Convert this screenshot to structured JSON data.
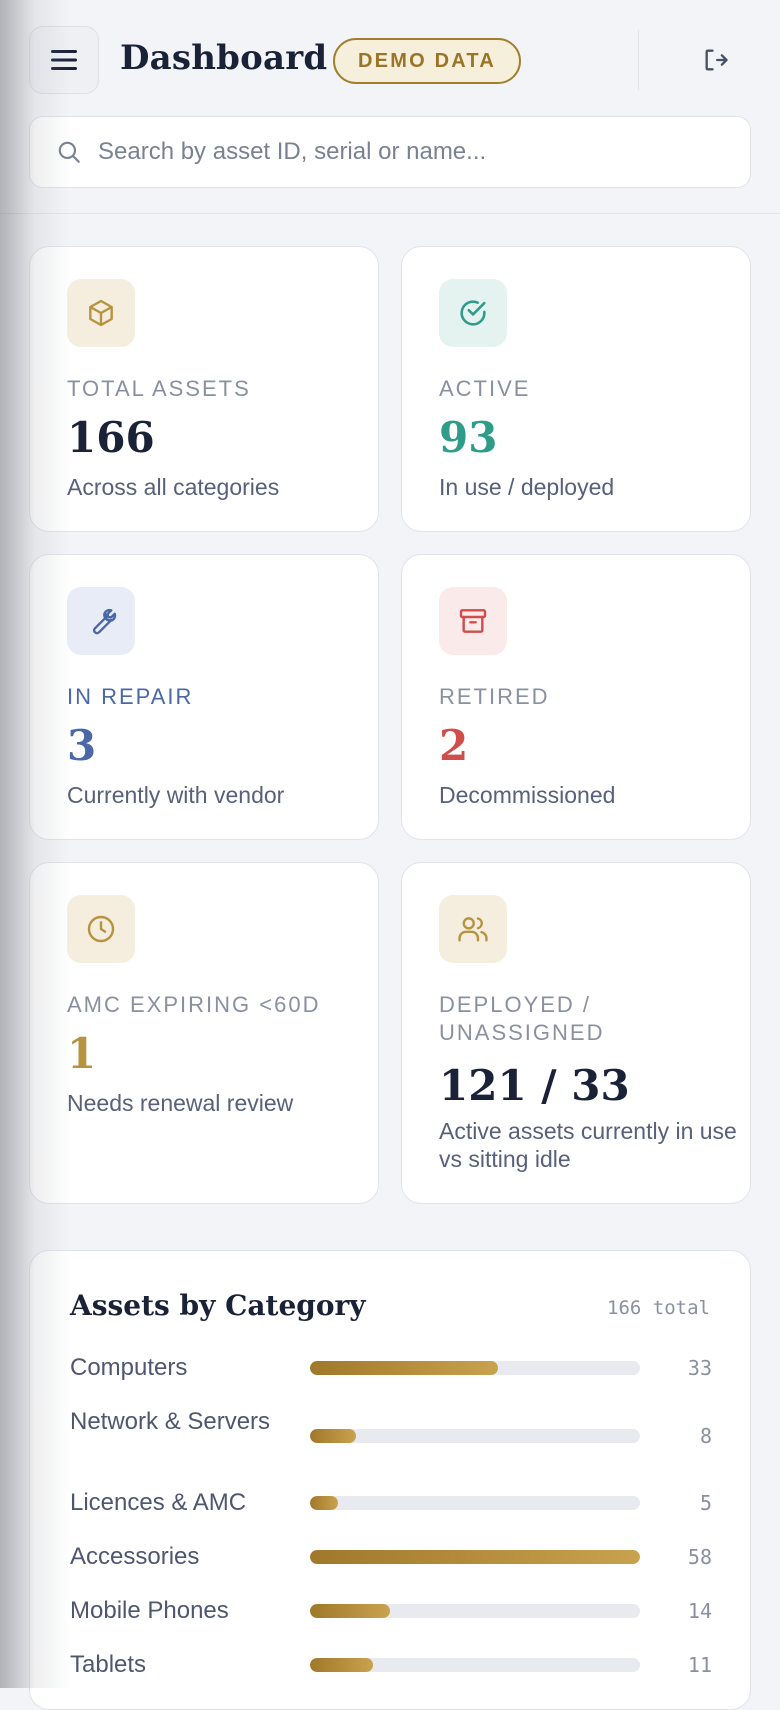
{
  "header": {
    "title": "Dashboard",
    "badge": "DEMO DATA",
    "menu_icon": "hamburger-menu-icon",
    "logout_icon": "logout-icon"
  },
  "search": {
    "placeholder": "Search by asset ID, serial or name...",
    "value": "",
    "icon": "search-icon"
  },
  "colors": {
    "gold": "#b8933f",
    "teal": "#2e9c88",
    "blue": "#4a68a8",
    "red": "#cf4d4a",
    "navy": "#1a2238"
  },
  "stats": [
    {
      "icon": "box-icon",
      "label": "TOTAL ASSETS",
      "value": "166",
      "desc": "Across all categories"
    },
    {
      "icon": "check-circle-icon",
      "label": "ACTIVE",
      "value": "93",
      "desc": "In use / deployed"
    },
    {
      "icon": "wrench-icon",
      "label": "IN REPAIR",
      "value": "3",
      "desc": "Currently with vendor"
    },
    {
      "icon": "archive-icon",
      "label": "RETIRED",
      "value": "2",
      "desc": "Decommissioned"
    },
    {
      "icon": "clock-icon",
      "label": "AMC EXPIRING <60D",
      "value": "1",
      "desc": "Needs renewal review"
    },
    {
      "icon": "users-icon",
      "label": "DEPLOYED / UNASSIGNED",
      "value": "121 / 33",
      "desc": "Active assets currently in use vs sitting idle"
    }
  ],
  "categories": {
    "title": "Assets by Category",
    "total_label": "166 total",
    "max": 58,
    "items": [
      {
        "name": "Computers",
        "count": 33
      },
      {
        "name": "Network & Servers",
        "count": 8
      },
      {
        "name": "Licences & AMC",
        "count": 5
      },
      {
        "name": "Accessories",
        "count": 58
      },
      {
        "name": "Mobile Phones",
        "count": 14
      },
      {
        "name": "Tablets",
        "count": 11
      }
    ]
  }
}
